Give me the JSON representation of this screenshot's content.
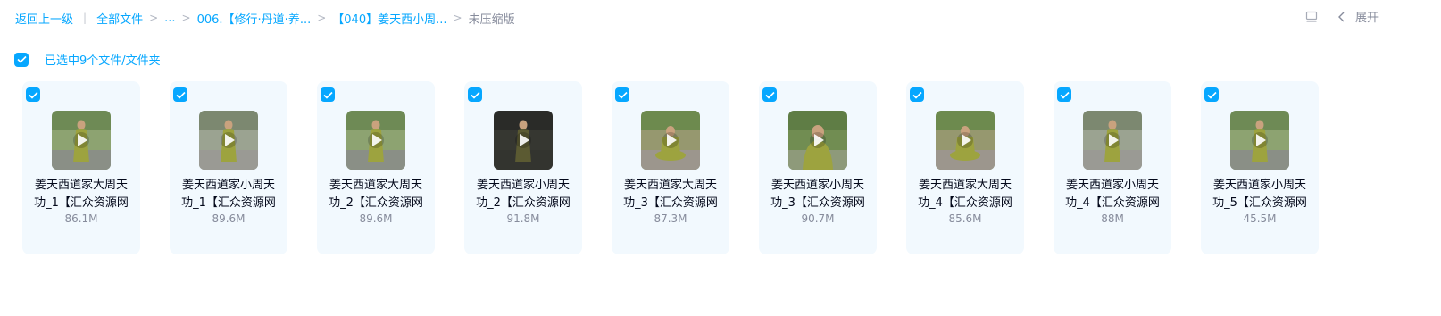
{
  "breadcrumb": {
    "back": "返回上一级",
    "all_files": "全部文件",
    "ellipsis": "...",
    "folder1": "006.【修行·丹道·养...",
    "folder2": "【040】姜天西小周...",
    "current": "未压缩版"
  },
  "toolbar": {
    "list_view_icon": "list-view-icon",
    "expand_label": "展开"
  },
  "selection": {
    "text": "已选中9个文件/文件夹",
    "checked": true
  },
  "colors": {
    "accent": "#06a7ff",
    "card_bg": "#f2f9fe",
    "muted": "#878c9c"
  },
  "files": [
    {
      "line1": "姜天西道家大周天",
      "line2": "功_1【汇众资源网",
      "size": "86.1M",
      "selected": true,
      "thumb": "standing-garden"
    },
    {
      "line1": "姜天西道家小周天",
      "line2": "功_1【汇众资源网",
      "size": "89.6M",
      "selected": true,
      "thumb": "standing-courtyard"
    },
    {
      "line1": "姜天西道家大周天",
      "line2": "功_2【汇众资源网",
      "size": "89.6M",
      "selected": true,
      "thumb": "standing-garden"
    },
    {
      "line1": "姜天西道家小周天",
      "line2": "功_2【汇众资源网",
      "size": "91.8M",
      "selected": true,
      "thumb": "dark"
    },
    {
      "line1": "姜天西道家大周天",
      "line2": "功_3【汇众资源网",
      "size": "87.3M",
      "selected": true,
      "thumb": "seated"
    },
    {
      "line1": "姜天西道家小周天",
      "line2": "功_3【汇众资源网",
      "size": "90.7M",
      "selected": true,
      "thumb": "closeup"
    },
    {
      "line1": "姜天西道家大周天",
      "line2": "功_4【汇众资源网",
      "size": "85.6M",
      "selected": true,
      "thumb": "seated"
    },
    {
      "line1": "姜天西道家小周天",
      "line2": "功_4【汇众资源网",
      "size": "88M",
      "selected": true,
      "thumb": "standing-courtyard"
    },
    {
      "line1": "姜天西道家小周天",
      "line2": "功_5【汇众资源网",
      "size": "45.5M",
      "selected": true,
      "thumb": "standing-garden"
    }
  ]
}
